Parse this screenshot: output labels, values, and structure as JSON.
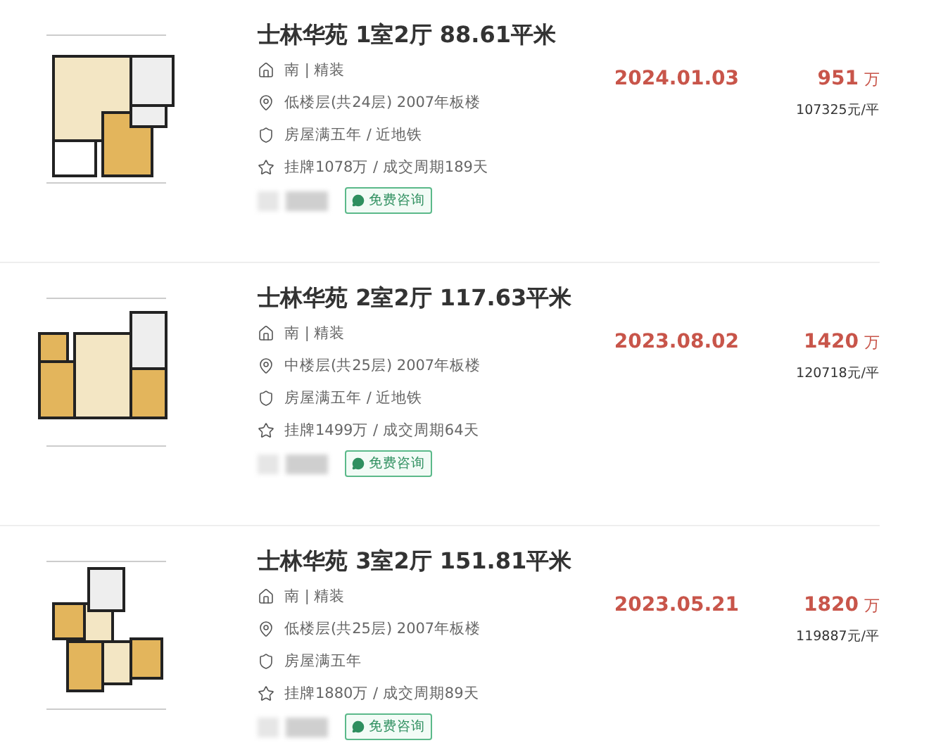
{
  "listings": [
    {
      "title": "士林华苑 1室2厅 88.61平米",
      "orientation": "南 | 精装",
      "floor": "低楼层(共24层) 2007年板楼",
      "tags": "房屋满五年 / 近地铁",
      "listing": "挂牌1078万 / 成交周期189天",
      "consult": "免费咨询",
      "date": "2024.01.03",
      "price": "951",
      "price_unit": "万",
      "unit_price": "107325元/平"
    },
    {
      "title": "士林华苑 2室2厅 117.63平米",
      "orientation": "南 | 精装",
      "floor": "中楼层(共25层) 2007年板楼",
      "tags": "房屋满五年 / 近地铁",
      "listing": "挂牌1499万 / 成交周期64天",
      "consult": "免费咨询",
      "date": "2023.08.02",
      "price": "1420",
      "price_unit": "万",
      "unit_price": "120718元/平"
    },
    {
      "title": "士林华苑 3室2厅 151.81平米",
      "orientation": "南 | 精装",
      "floor": "低楼层(共25层) 2007年板楼",
      "tags": "房屋满五年",
      "listing": "挂牌1880万 / 成交周期89天",
      "consult": "免费咨询",
      "date": "2023.05.21",
      "price": "1820",
      "price_unit": "万",
      "unit_price": "119887元/平"
    }
  ]
}
